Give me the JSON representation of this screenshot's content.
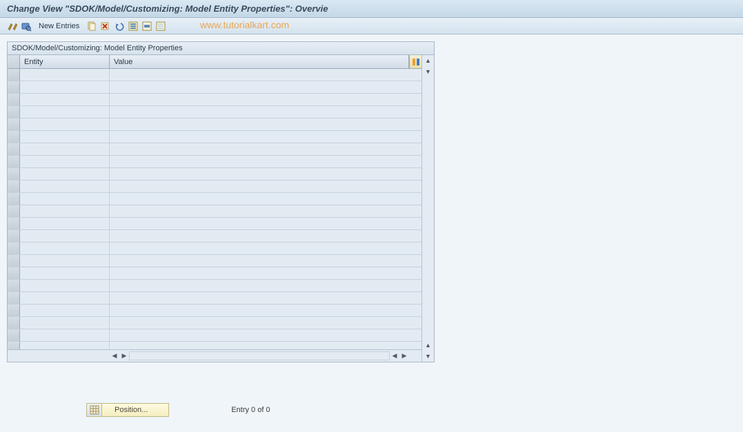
{
  "title": "Change View \"SDOK/Model/Customizing: Model Entity Properties\": Overvie",
  "toolbar": {
    "new_entries_label": "New Entries"
  },
  "watermark": "www.tutorialkart.com",
  "panel": {
    "header": "SDOK/Model/Customizing: Model Entity Properties",
    "columns": {
      "entity": "Entity",
      "value": "Value"
    },
    "rows": [
      {
        "entity": "",
        "value": ""
      },
      {
        "entity": "",
        "value": ""
      },
      {
        "entity": "",
        "value": ""
      },
      {
        "entity": "",
        "value": ""
      },
      {
        "entity": "",
        "value": ""
      },
      {
        "entity": "",
        "value": ""
      },
      {
        "entity": "",
        "value": ""
      },
      {
        "entity": "",
        "value": ""
      },
      {
        "entity": "",
        "value": ""
      },
      {
        "entity": "",
        "value": ""
      },
      {
        "entity": "",
        "value": ""
      },
      {
        "entity": "",
        "value": ""
      },
      {
        "entity": "",
        "value": ""
      },
      {
        "entity": "",
        "value": ""
      },
      {
        "entity": "",
        "value": ""
      },
      {
        "entity": "",
        "value": ""
      },
      {
        "entity": "",
        "value": ""
      },
      {
        "entity": "",
        "value": ""
      },
      {
        "entity": "",
        "value": ""
      },
      {
        "entity": "",
        "value": ""
      },
      {
        "entity": "",
        "value": ""
      },
      {
        "entity": "",
        "value": ""
      },
      {
        "entity": "",
        "value": ""
      }
    ]
  },
  "footer": {
    "position_label": "Position...",
    "entry_status": "Entry 0 of 0"
  },
  "icons": {
    "toggle": "toggle-display-change-icon",
    "detail": "detail-icon",
    "copy": "copy-icon",
    "delete": "delete-icon",
    "undo": "undo-icon",
    "select_all": "select-all-icon",
    "select_block": "select-block-icon",
    "deselect": "deselect-all-icon",
    "config": "configure-columns-icon",
    "grid": "grid-icon"
  }
}
